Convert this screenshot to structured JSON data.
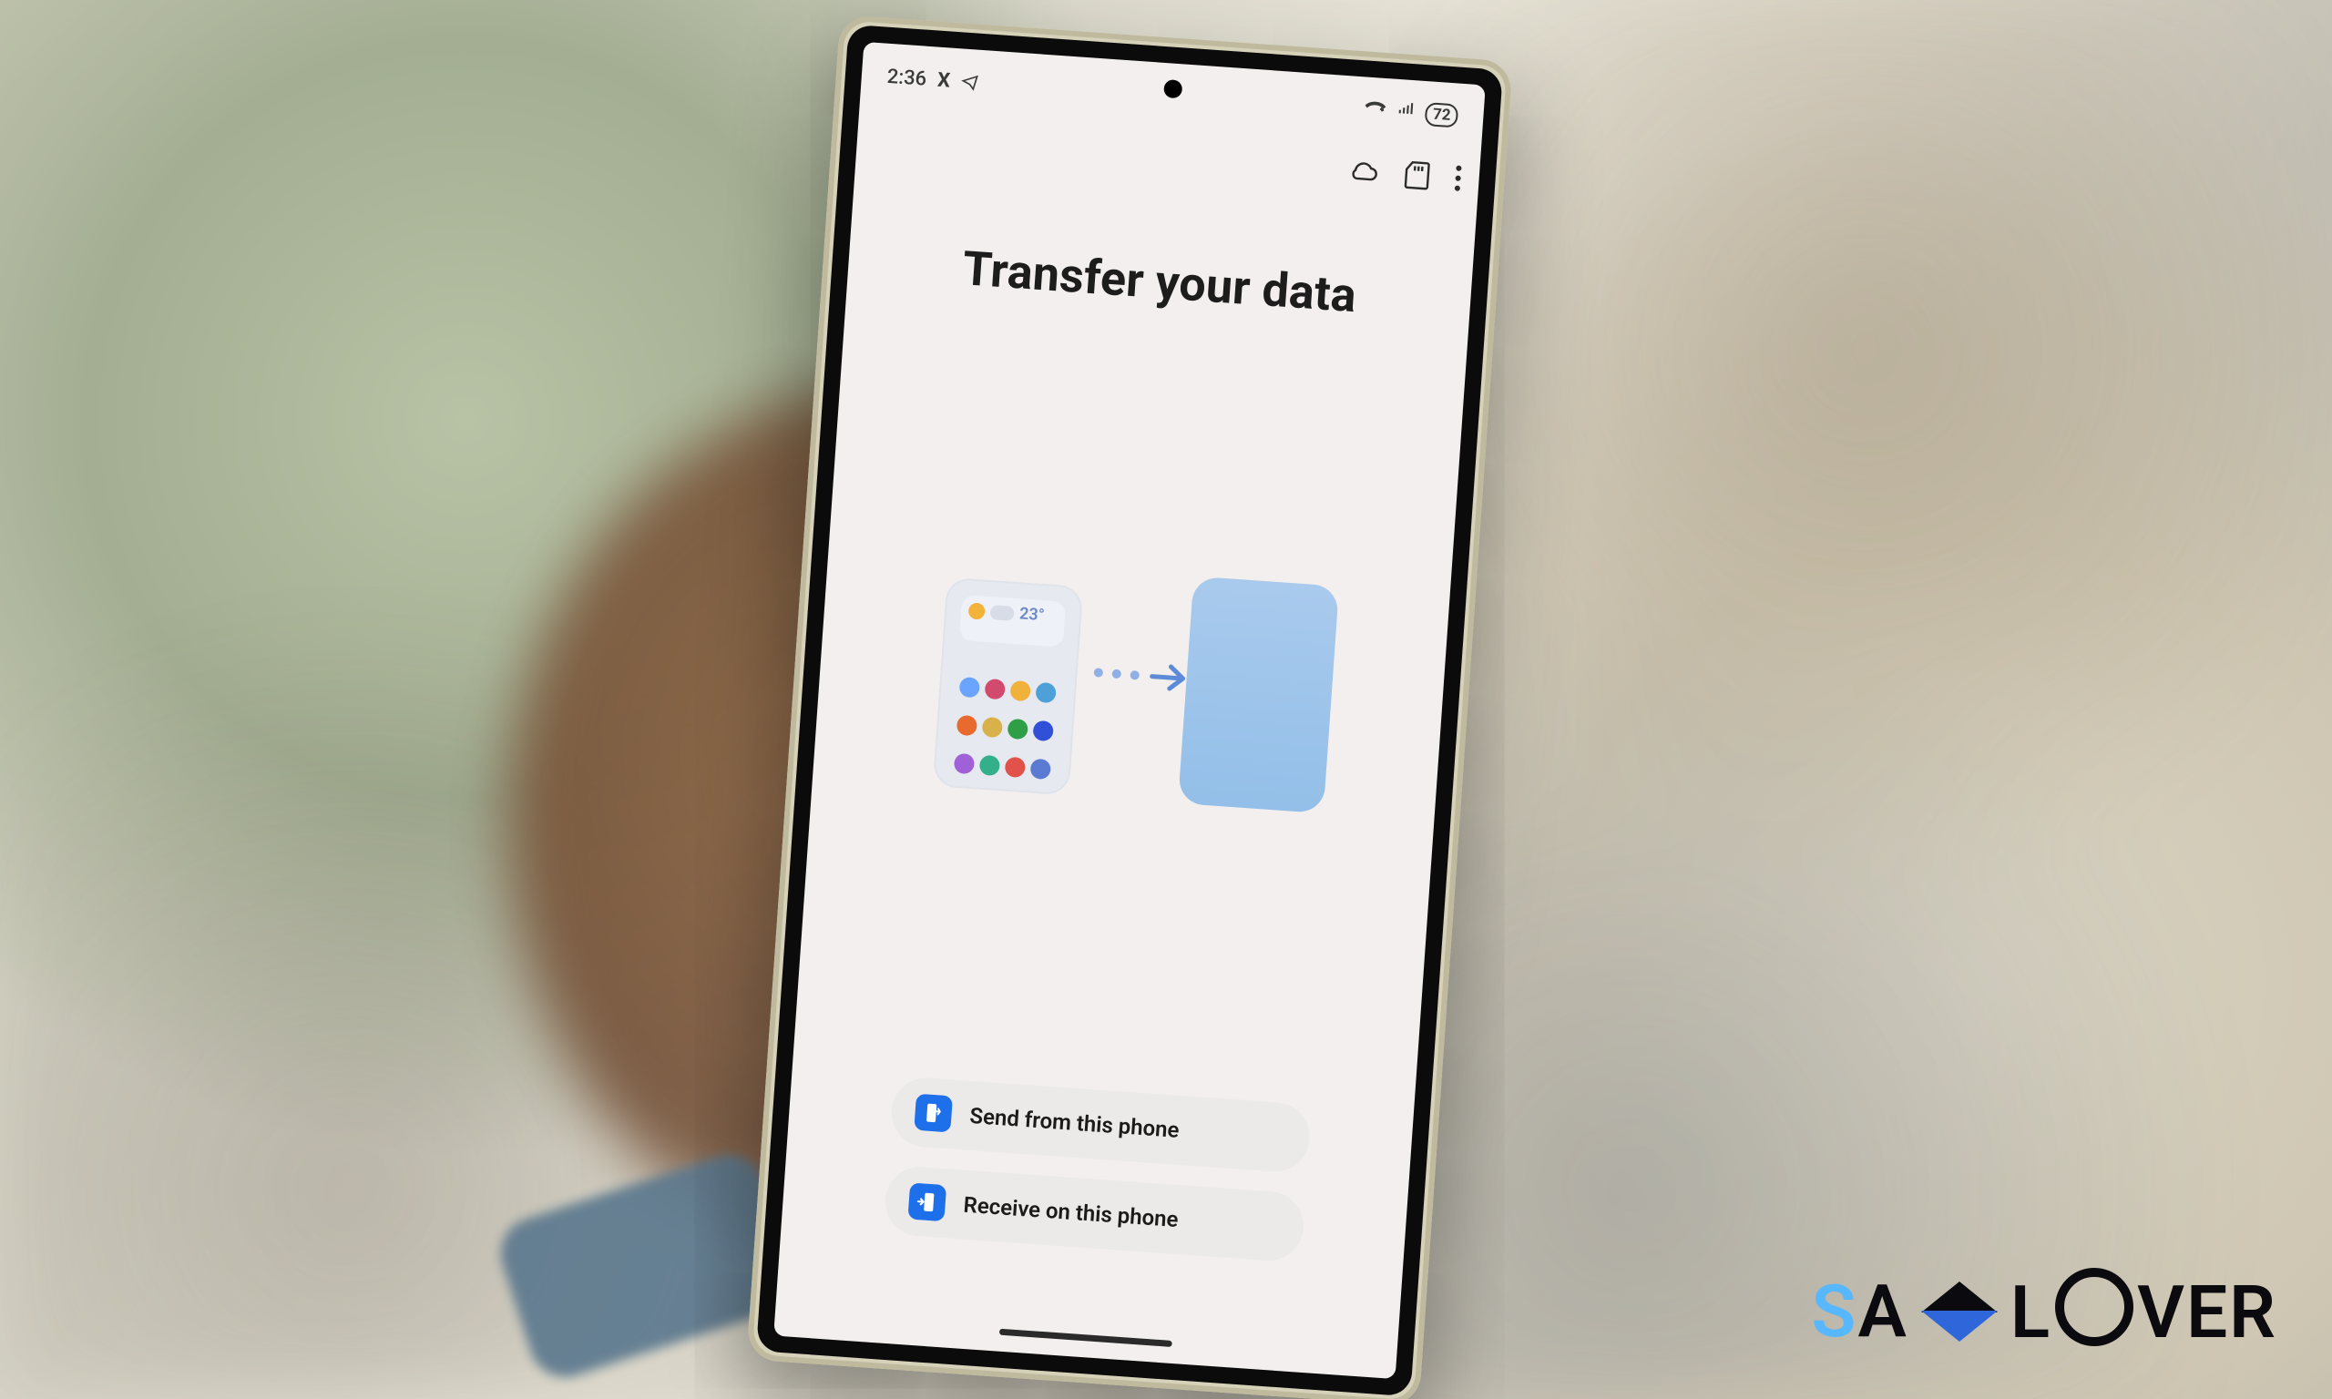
{
  "status_bar": {
    "time": "2:36",
    "x_icon_label": "X",
    "wifi_calling": true,
    "signal": true,
    "battery_percent": "72"
  },
  "app_bar": {
    "cloud_icon": "cloud-icon",
    "sd_icon": "sd-card-icon",
    "more_icon": "more-icon"
  },
  "page": {
    "title": "Transfer your data"
  },
  "illustration": {
    "temperature": "23°",
    "dot_colors_row1": [
      "#6aa4ff",
      "#d24a6e",
      "#f0b23d",
      "#4da0d8"
    ],
    "dot_colors_row2": [
      "#e86a2e",
      "#d9b14a",
      "#2f9f46",
      "#3050d8"
    ],
    "dot_colors_row3": [
      "#a060d8",
      "#33b08a",
      "#e1524a",
      "#5a7bd1"
    ]
  },
  "actions": {
    "send_label": "Send from this phone",
    "receive_label": "Receive on this phone"
  },
  "watermark": "SA   LOVER",
  "brand": {
    "text_left": "SA",
    "text_right_l": "L",
    "text_right_ver": "VER"
  }
}
